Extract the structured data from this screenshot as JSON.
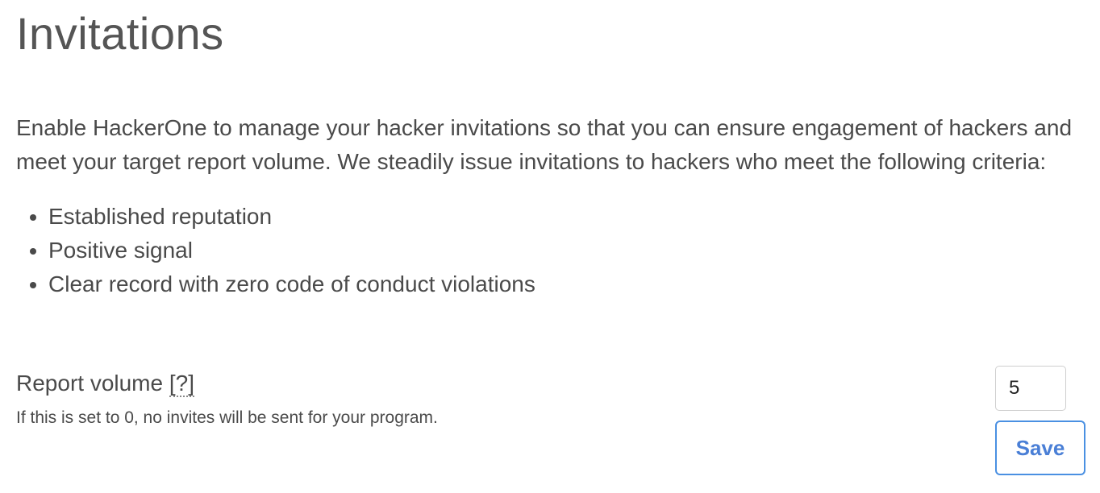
{
  "page": {
    "title": "Invitations",
    "intro": "Enable HackerOne to manage your hacker invitations so that you can ensure engagement of hackers and meet your target report volume. We steadily issue invitations to hackers who meet the following criteria:",
    "criteria": [
      "Established reputation",
      "Positive signal",
      "Clear record with zero code of conduct violations"
    ]
  },
  "report_volume": {
    "label": "Report volume",
    "help_link": "[?]",
    "help_text": "If this is set to 0, no invites will be sent for your program.",
    "value": "5",
    "save_label": "Save"
  },
  "colors": {
    "save_border": "#4a90e2",
    "save_text": "#4a7fd6",
    "text": "#4a4a4a"
  }
}
